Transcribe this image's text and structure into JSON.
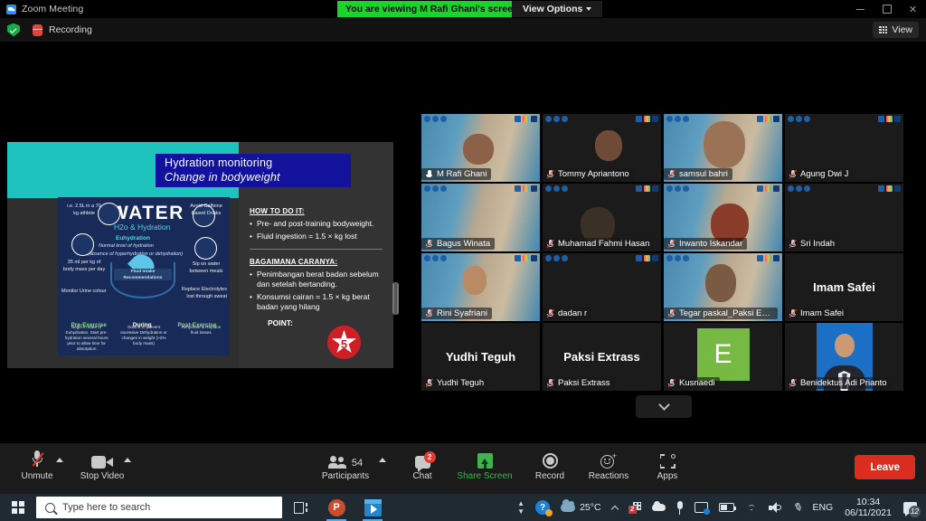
{
  "window": {
    "app_title": "Zoom Meeting",
    "viewing_banner": "You are viewing M Rafi Ghani's screen",
    "view_options_label": "View Options",
    "minimize_label": "",
    "maximize_label": "",
    "close_label": "✕"
  },
  "statusbar": {
    "recording_label": "Recording",
    "view_label": "View"
  },
  "slide": {
    "title_line1": "Hydration monitoring",
    "title_line2": "Change in bodyweight",
    "infographic": {
      "heading": "WATER",
      "subheading": "H2o & Hydration",
      "euhydration": "Euhydration",
      "euhydration_sub1": "Normal level of hydration",
      "euhydration_sub2": "(absence of hyperhydration or dehydration)",
      "left_top": "i.e. 2.5L in a 70 kg athlete",
      "left_mid": "35 ml per kg of body mass per day",
      "left_bottom": "Monitor Urine colour",
      "right_top": "Avoid Caffeine Based Drinks",
      "right_mid": "Sip on water between meals",
      "right_bottom": "Replace Electrolytes lost through sweat",
      "center_label": "Fluid Intake Recommendations",
      "phases": [
        "Pre-Exercise",
        "During",
        "Post-Exercise"
      ],
      "phase_text_1": "Begin in state of Euhydration. Start pre-hydration several hours prior to allow time for absorption",
      "phase_text_2": "Goal is to prevent excessive Dehydration or changes in weight (>2% body mass)",
      "phase_text_3": "Rehydrate & Replace fluid losses"
    },
    "panel": {
      "heading_en": "HOW TO DO IT:",
      "bullets_en": [
        "Pre- and post-training bodyweight.",
        "Fluid ingestion = 1.5 × kg lost"
      ],
      "heading_id": "BAGAIMANA CARANYA:",
      "bullets_id": [
        "Penimbangan berat badan sebelum dan setelah bertanding.",
        "Konsumsi cairan = 1.5 × kg berat badan yang hilang"
      ],
      "point_label": "POINT:",
      "point_value": "5"
    },
    "colors": {
      "teal": "#1fc3bd",
      "title_navy": "#12129c",
      "panel_gray": "#333333",
      "infographic_navy": "#182a58",
      "point_red": "#cf1f26"
    }
  },
  "participants": [
    {
      "name": "M Rafi Ghani",
      "kind": "video",
      "muted": false,
      "active": true
    },
    {
      "name": "Tommy Apriantono",
      "kind": "video",
      "muted": true,
      "active": false
    },
    {
      "name": "samsul bahri",
      "kind": "video",
      "muted": true,
      "active": false
    },
    {
      "name": "Agung Dwi J",
      "kind": "video",
      "muted": true,
      "active": false
    },
    {
      "name": "Bagus Winata",
      "kind": "video",
      "muted": true,
      "active": false
    },
    {
      "name": "Muhamad Fahmi Hasan",
      "kind": "video",
      "muted": true,
      "active": false
    },
    {
      "name": "Irwanto Iskandar",
      "kind": "video",
      "muted": true,
      "active": false
    },
    {
      "name": "Sri Indah",
      "kind": "video",
      "muted": true,
      "active": false
    },
    {
      "name": "Rini Syafriani",
      "kind": "video",
      "muted": true,
      "active": false
    },
    {
      "name": "dadan r",
      "kind": "video",
      "muted": true,
      "active": false
    },
    {
      "name": "Tegar paskal_Paksi Extr...",
      "kind": "video",
      "muted": true,
      "active": false
    },
    {
      "name": "Imam Safei",
      "kind": "name",
      "muted": true,
      "active": false,
      "display_name": "Imam Safei"
    },
    {
      "name": "Yudhi Teguh",
      "kind": "name",
      "muted": true,
      "active": false,
      "display_name": "Yudhi Teguh"
    },
    {
      "name": "Paksi Extrass",
      "kind": "name",
      "muted": true,
      "active": false,
      "display_name": "Paksi Extrass"
    },
    {
      "name": "Kusnaedi",
      "kind": "initial",
      "muted": true,
      "active": false,
      "initial": "E"
    },
    {
      "name": "Benidektus Adi Prianto",
      "kind": "photo",
      "muted": true,
      "active": false
    }
  ],
  "toolbar": {
    "unmute_label": "Unmute",
    "stop_video_label": "Stop Video",
    "participants_label": "Participants",
    "participants_count": "54",
    "chat_label": "Chat",
    "chat_badge": "2",
    "share_screen_label": "Share Screen",
    "record_label": "Record",
    "reactions_label": "Reactions",
    "apps_label": "Apps",
    "leave_label": "Leave"
  },
  "taskbar": {
    "search_placeholder": "Type here to search",
    "temperature": "25°C",
    "language": "ENG",
    "time": "10:34",
    "date": "06/11/2021",
    "notification_count": "12",
    "teams_badge": "2",
    "help_glyph": "?"
  }
}
